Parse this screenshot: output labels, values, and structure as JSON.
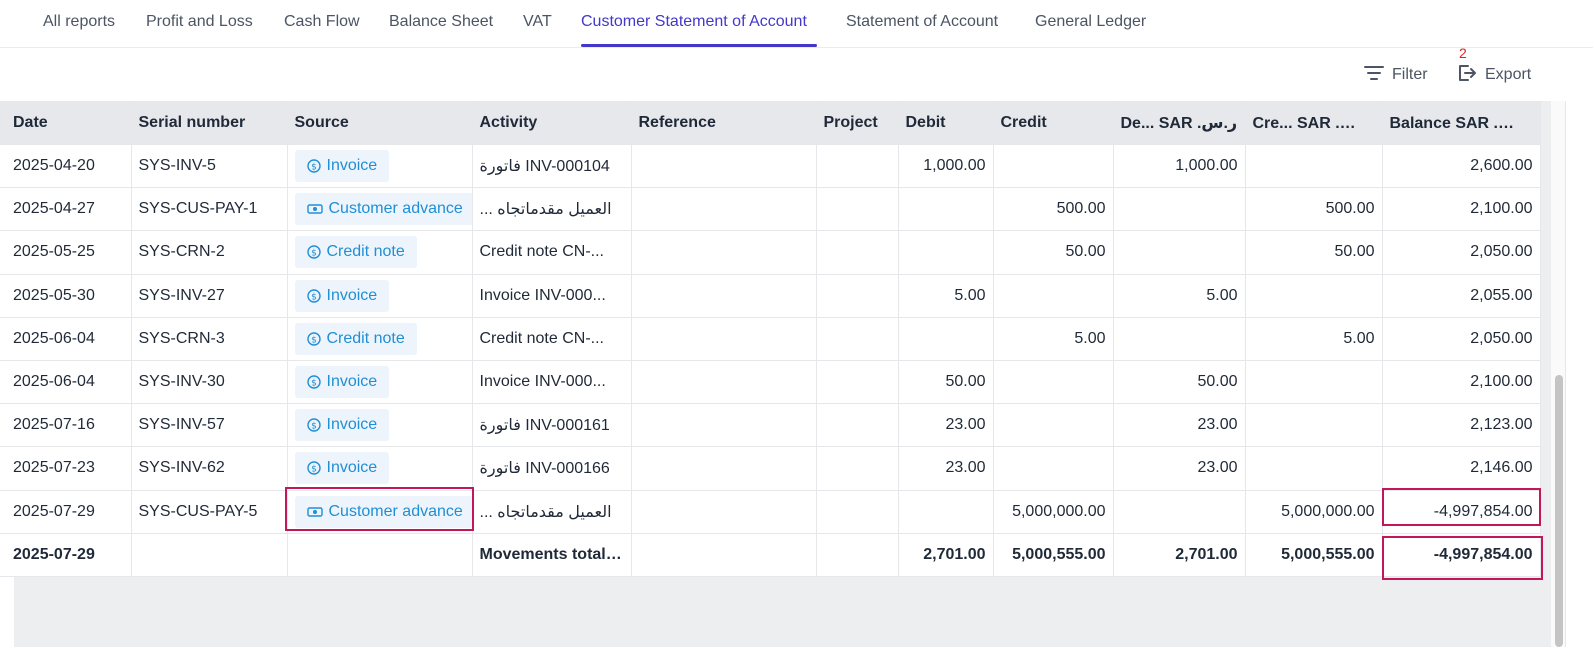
{
  "tabs": [
    "All reports",
    "Profit and Loss",
    "Cash Flow",
    "Balance Sheet",
    "VAT",
    "Customer Statement of Account",
    "Statement of Account",
    "General Ledger"
  ],
  "active_tab": "Customer Statement of Account",
  "toolbar": {
    "filter_label": "Filter",
    "filter_count": "2",
    "export_label": "Export"
  },
  "columns": {
    "date": "Date",
    "serial": "Serial number",
    "source": "Source",
    "activity": "Activity",
    "reference": "Reference",
    "project": "Project",
    "debit": "Debit",
    "credit": "Credit",
    "debit_sar": "De...  SAR .ر.س",
    "credit_sar": "Cre...  SAR .ر.س",
    "balance_sar": "Balance  SAR .ر.س"
  },
  "rows": [
    {
      "date": "2025-04-20",
      "serial": "SYS-INV-5",
      "source": "Invoice",
      "source_icon": "dollar-circle-icon",
      "activity": "فاتورة INV-000104",
      "reference": "",
      "project": "",
      "debit": "1,000.00",
      "credit": "",
      "debit_sar": "1,000.00",
      "credit_sar": "",
      "balance_sar": "2,600.00"
    },
    {
      "date": "2025-04-27",
      "serial": "SYS-CUS-PAY-1",
      "source": "Customer advance",
      "source_icon": "cash-icon",
      "activity": "... العميل مقدماتجاه",
      "reference": "",
      "project": "",
      "debit": "",
      "credit": "500.00",
      "debit_sar": "",
      "credit_sar": "500.00",
      "balance_sar": "2,100.00"
    },
    {
      "date": "2025-05-25",
      "serial": "SYS-CRN-2",
      "source": "Credit note",
      "source_icon": "dollar-circle-icon",
      "activity": "Credit note CN-...",
      "reference": "",
      "project": "",
      "debit": "",
      "credit": "50.00",
      "debit_sar": "",
      "credit_sar": "50.00",
      "balance_sar": "2,050.00"
    },
    {
      "date": "2025-05-30",
      "serial": "SYS-INV-27",
      "source": "Invoice",
      "source_icon": "dollar-circle-icon",
      "activity": "Invoice INV-000...",
      "reference": "",
      "project": "",
      "debit": "5.00",
      "credit": "",
      "debit_sar": "5.00",
      "credit_sar": "",
      "balance_sar": "2,055.00"
    },
    {
      "date": "2025-06-04",
      "serial": "SYS-CRN-3",
      "source": "Credit note",
      "source_icon": "dollar-circle-icon",
      "activity": "Credit note CN-...",
      "reference": "",
      "project": "",
      "debit": "",
      "credit": "5.00",
      "debit_sar": "",
      "credit_sar": "5.00",
      "balance_sar": "2,050.00"
    },
    {
      "date": "2025-06-04",
      "serial": "SYS-INV-30",
      "source": "Invoice",
      "source_icon": "dollar-circle-icon",
      "activity": "Invoice INV-000...",
      "reference": "",
      "project": "",
      "debit": "50.00",
      "credit": "",
      "debit_sar": "50.00",
      "credit_sar": "",
      "balance_sar": "2,100.00"
    },
    {
      "date": "2025-07-16",
      "serial": "SYS-INV-57",
      "source": "Invoice",
      "source_icon": "dollar-circle-icon",
      "activity": "فاتورة INV-000161",
      "reference": "",
      "project": "",
      "debit": "23.00",
      "credit": "",
      "debit_sar": "23.00",
      "credit_sar": "",
      "balance_sar": "2,123.00"
    },
    {
      "date": "2025-07-23",
      "serial": "SYS-INV-62",
      "source": "Invoice",
      "source_icon": "dollar-circle-icon",
      "activity": "فاتورة INV-000166",
      "reference": "",
      "project": "",
      "debit": "23.00",
      "credit": "",
      "debit_sar": "23.00",
      "credit_sar": "",
      "balance_sar": "2,146.00"
    },
    {
      "date": "2025-07-29",
      "serial": "SYS-CUS-PAY-5",
      "source": "Customer advance",
      "source_icon": "cash-icon",
      "activity": "... العميل مقدماتجاه",
      "reference": "",
      "project": "",
      "debit": "",
      "credit": "5,000,000.00",
      "debit_sar": "",
      "credit_sar": "5,000,000.00",
      "balance_sar": "-4,997,854.00"
    }
  ],
  "total": {
    "date": "2025-07-29",
    "serial": "",
    "source": "",
    "activity": "Movements total ar",
    "reference": "",
    "project": "",
    "debit": "2,701.00",
    "credit": "5,000,555.00",
    "debit_sar": "2,701.00",
    "credit_sar": "5,000,555.00",
    "balance_sar": "-4,997,854.00"
  },
  "colors": {
    "accent": "#4338ca",
    "source_link": "#1f8fd6",
    "source_bg": "#eef4fb",
    "highlight": "#c2185b",
    "badge": "#dc2626"
  }
}
